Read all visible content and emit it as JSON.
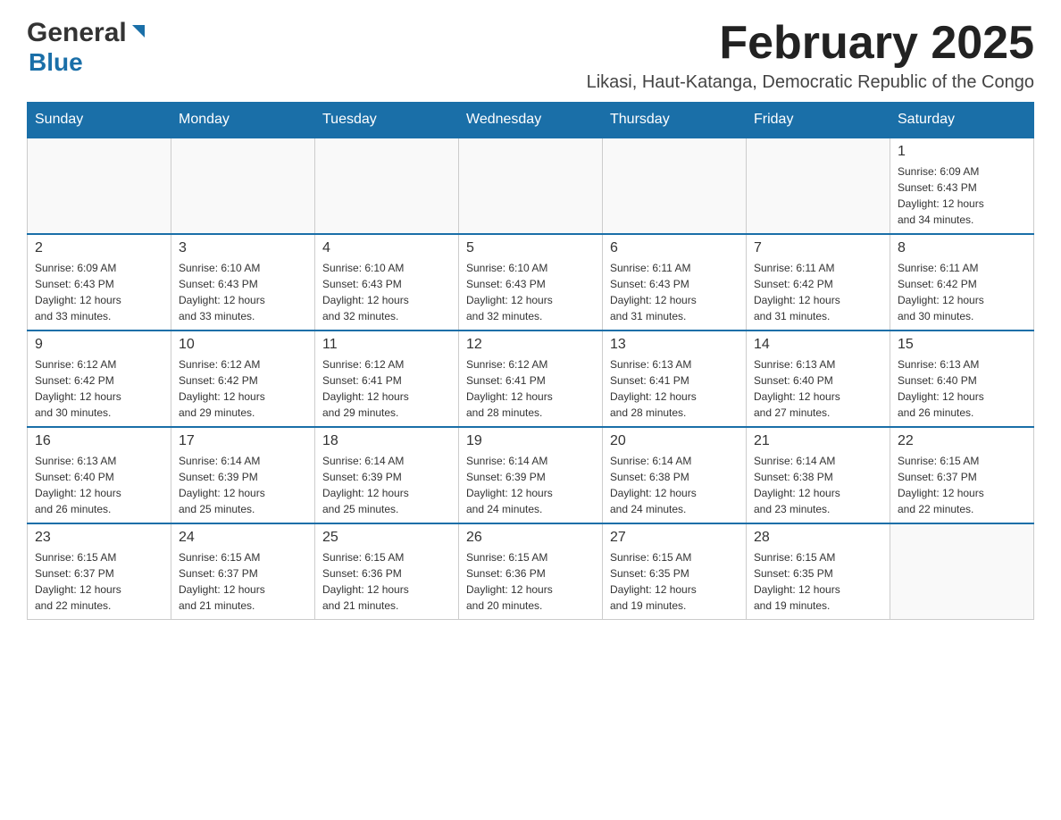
{
  "header": {
    "logo_general": "General",
    "logo_blue": "Blue",
    "month_title": "February 2025",
    "location": "Likasi, Haut-Katanga, Democratic Republic of the Congo"
  },
  "days_of_week": [
    "Sunday",
    "Monday",
    "Tuesday",
    "Wednesday",
    "Thursday",
    "Friday",
    "Saturday"
  ],
  "weeks": [
    [
      {
        "day": "",
        "info": ""
      },
      {
        "day": "",
        "info": ""
      },
      {
        "day": "",
        "info": ""
      },
      {
        "day": "",
        "info": ""
      },
      {
        "day": "",
        "info": ""
      },
      {
        "day": "",
        "info": ""
      },
      {
        "day": "1",
        "info": "Sunrise: 6:09 AM\nSunset: 6:43 PM\nDaylight: 12 hours\nand 34 minutes."
      }
    ],
    [
      {
        "day": "2",
        "info": "Sunrise: 6:09 AM\nSunset: 6:43 PM\nDaylight: 12 hours\nand 33 minutes."
      },
      {
        "day": "3",
        "info": "Sunrise: 6:10 AM\nSunset: 6:43 PM\nDaylight: 12 hours\nand 33 minutes."
      },
      {
        "day": "4",
        "info": "Sunrise: 6:10 AM\nSunset: 6:43 PM\nDaylight: 12 hours\nand 32 minutes."
      },
      {
        "day": "5",
        "info": "Sunrise: 6:10 AM\nSunset: 6:43 PM\nDaylight: 12 hours\nand 32 minutes."
      },
      {
        "day": "6",
        "info": "Sunrise: 6:11 AM\nSunset: 6:43 PM\nDaylight: 12 hours\nand 31 minutes."
      },
      {
        "day": "7",
        "info": "Sunrise: 6:11 AM\nSunset: 6:42 PM\nDaylight: 12 hours\nand 31 minutes."
      },
      {
        "day": "8",
        "info": "Sunrise: 6:11 AM\nSunset: 6:42 PM\nDaylight: 12 hours\nand 30 minutes."
      }
    ],
    [
      {
        "day": "9",
        "info": "Sunrise: 6:12 AM\nSunset: 6:42 PM\nDaylight: 12 hours\nand 30 minutes."
      },
      {
        "day": "10",
        "info": "Sunrise: 6:12 AM\nSunset: 6:42 PM\nDaylight: 12 hours\nand 29 minutes."
      },
      {
        "day": "11",
        "info": "Sunrise: 6:12 AM\nSunset: 6:41 PM\nDaylight: 12 hours\nand 29 minutes."
      },
      {
        "day": "12",
        "info": "Sunrise: 6:12 AM\nSunset: 6:41 PM\nDaylight: 12 hours\nand 28 minutes."
      },
      {
        "day": "13",
        "info": "Sunrise: 6:13 AM\nSunset: 6:41 PM\nDaylight: 12 hours\nand 28 minutes."
      },
      {
        "day": "14",
        "info": "Sunrise: 6:13 AM\nSunset: 6:40 PM\nDaylight: 12 hours\nand 27 minutes."
      },
      {
        "day": "15",
        "info": "Sunrise: 6:13 AM\nSunset: 6:40 PM\nDaylight: 12 hours\nand 26 minutes."
      }
    ],
    [
      {
        "day": "16",
        "info": "Sunrise: 6:13 AM\nSunset: 6:40 PM\nDaylight: 12 hours\nand 26 minutes."
      },
      {
        "day": "17",
        "info": "Sunrise: 6:14 AM\nSunset: 6:39 PM\nDaylight: 12 hours\nand 25 minutes."
      },
      {
        "day": "18",
        "info": "Sunrise: 6:14 AM\nSunset: 6:39 PM\nDaylight: 12 hours\nand 25 minutes."
      },
      {
        "day": "19",
        "info": "Sunrise: 6:14 AM\nSunset: 6:39 PM\nDaylight: 12 hours\nand 24 minutes."
      },
      {
        "day": "20",
        "info": "Sunrise: 6:14 AM\nSunset: 6:38 PM\nDaylight: 12 hours\nand 24 minutes."
      },
      {
        "day": "21",
        "info": "Sunrise: 6:14 AM\nSunset: 6:38 PM\nDaylight: 12 hours\nand 23 minutes."
      },
      {
        "day": "22",
        "info": "Sunrise: 6:15 AM\nSunset: 6:37 PM\nDaylight: 12 hours\nand 22 minutes."
      }
    ],
    [
      {
        "day": "23",
        "info": "Sunrise: 6:15 AM\nSunset: 6:37 PM\nDaylight: 12 hours\nand 22 minutes."
      },
      {
        "day": "24",
        "info": "Sunrise: 6:15 AM\nSunset: 6:37 PM\nDaylight: 12 hours\nand 21 minutes."
      },
      {
        "day": "25",
        "info": "Sunrise: 6:15 AM\nSunset: 6:36 PM\nDaylight: 12 hours\nand 21 minutes."
      },
      {
        "day": "26",
        "info": "Sunrise: 6:15 AM\nSunset: 6:36 PM\nDaylight: 12 hours\nand 20 minutes."
      },
      {
        "day": "27",
        "info": "Sunrise: 6:15 AM\nSunset: 6:35 PM\nDaylight: 12 hours\nand 19 minutes."
      },
      {
        "day": "28",
        "info": "Sunrise: 6:15 AM\nSunset: 6:35 PM\nDaylight: 12 hours\nand 19 minutes."
      },
      {
        "day": "",
        "info": ""
      }
    ]
  ]
}
